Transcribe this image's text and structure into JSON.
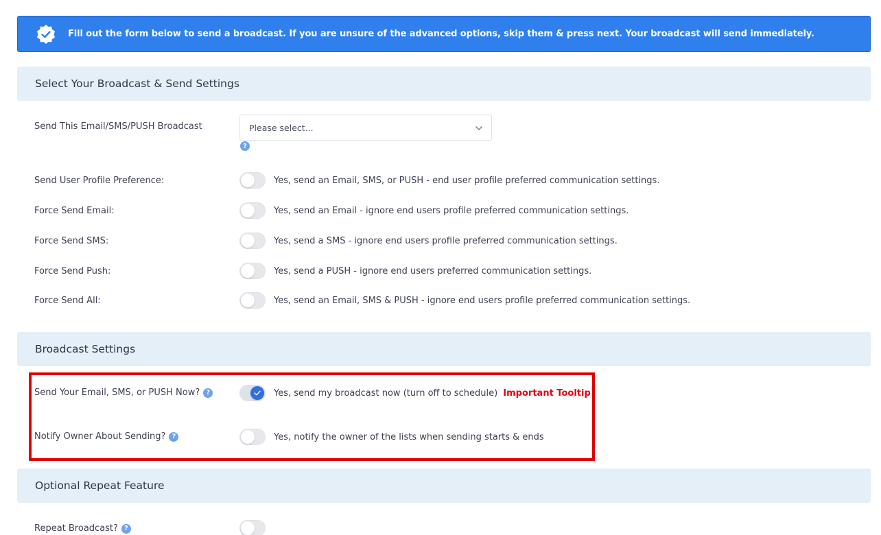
{
  "alert": {
    "text": "Fill out the form below to send a broadcast. If you are unsure of the advanced options, skip them & press next. Your broadcast will send immediately.",
    "icon": "verified-badge-icon"
  },
  "sections": {
    "send_settings": "Select Your Broadcast & Send Settings",
    "broadcast_settings": "Broadcast Settings",
    "repeat": "Optional Repeat Feature"
  },
  "broadcast_select": {
    "label": "Send This Email/SMS/PUSH Broadcast",
    "value": "Please select..."
  },
  "send_rows": [
    {
      "label": "Send User Profile Preference:",
      "text": "Yes, send an Email, SMS, or PUSH - end user profile preferred communication settings.",
      "on": false
    },
    {
      "label": "Force Send Email:",
      "text": "Yes, send an Email - ignore end users profile preferred communication settings.",
      "on": false
    },
    {
      "label": "Force Send SMS:",
      "text": "Yes, send a SMS - ignore end users profile preferred communication settings.",
      "on": false
    },
    {
      "label": "Force Send Push:",
      "text": "Yes, send a PUSH - ignore end users preferred communication settings.",
      "on": false
    },
    {
      "label": "Force Send All:",
      "text": "Yes, send an Email, SMS & PUSH - ignore end users profile preferred communication settings.",
      "on": false
    }
  ],
  "broadcast_rows": [
    {
      "label": "Send Your Email, SMS, or PUSH Now?",
      "text": "Yes, send my broadcast now (turn off to schedule)",
      "extra": "Important Tooltip",
      "on": true
    },
    {
      "label": "Notify Owner About Sending?",
      "text": "Yes, notify the owner of the lists when sending starts & ends",
      "on": false
    }
  ],
  "repeat_row": {
    "label": "Repeat Broadcast?",
    "on": false
  },
  "help_glyph": "?",
  "colors": {
    "primary": "#2f80ed",
    "section_bg": "#e4eff8",
    "highlight": "#e00000",
    "tooltip": "#e60012"
  }
}
